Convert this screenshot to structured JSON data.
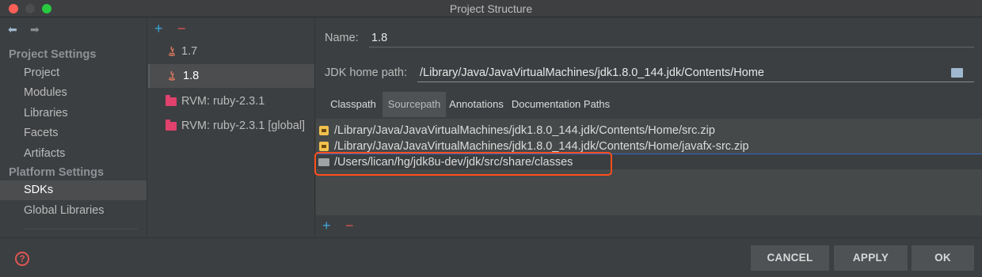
{
  "window": {
    "title": "Project Structure"
  },
  "nav": {
    "back_icon": "arrow-left-icon",
    "forward_icon": "arrow-right-icon",
    "sections": [
      {
        "header": "Project Settings",
        "items": [
          "Project",
          "Modules",
          "Libraries",
          "Facets",
          "Artifacts"
        ]
      },
      {
        "header": "Platform Settings",
        "items": [
          "SDKs",
          "Global Libraries"
        ]
      }
    ],
    "selected": "SDKs"
  },
  "sdk_list": {
    "add_label": "+",
    "remove_label": "−",
    "items": [
      {
        "label": "1.7",
        "icon": "java-icon"
      },
      {
        "label": "1.8",
        "icon": "java-icon",
        "selected": true
      },
      {
        "label": "RVM: ruby-2.3.1",
        "icon": "ruby-folder-icon"
      },
      {
        "label": "RVM: ruby-2.3.1 [global]",
        "icon": "ruby-folder-icon"
      }
    ]
  },
  "details": {
    "name_label": "Name:",
    "name_value": "1.8",
    "jdk_label": "JDK home path:",
    "jdk_value": "/Library/Java/JavaVirtualMachines/jdk1.8.0_144.jdk/Contents/Home",
    "tabs": [
      "Classpath",
      "Sourcepath",
      "Annotations",
      "Documentation Paths"
    ],
    "active_tab": "Sourcepath",
    "paths": [
      {
        "text": "/Library/Java/JavaVirtualMachines/jdk1.8.0_144.jdk/Contents/Home/src.zip",
        "icon": "archive-icon"
      },
      {
        "text": "/Library/Java/JavaVirtualMachines/jdk1.8.0_144.jdk/Contents/Home/javafx-src.zip",
        "icon": "archive-icon"
      },
      {
        "text": "/Users/lican/hg/jdk8u-dev/jdk/src/share/classes",
        "icon": "folder-icon",
        "selected": true
      }
    ],
    "add_label": "+",
    "remove_label": "−"
  },
  "footer": {
    "help_label": "?",
    "cancel": "CANCEL",
    "apply": "APPLY",
    "ok": "OK"
  },
  "colors": {
    "background": "#3c3f41",
    "selection": "#4b4d4f",
    "accent_blue": "#3aa5d9",
    "accent_red": "#e05555",
    "highlight_box": "#ff4e1c"
  }
}
